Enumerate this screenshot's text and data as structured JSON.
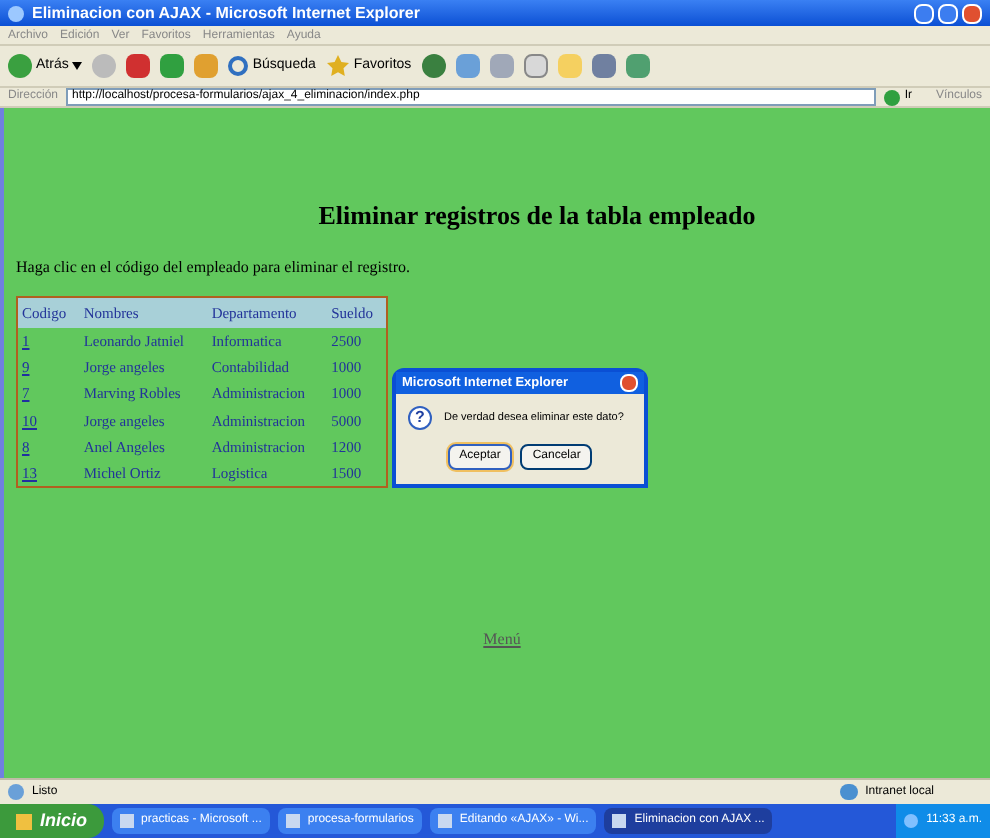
{
  "window": {
    "title": "Eliminacion con AJAX - Microsoft Internet Explorer"
  },
  "menu": [
    "Archivo",
    "Edición",
    "Ver",
    "Favoritos",
    "Herramientas",
    "Ayuda"
  ],
  "toolbar": {
    "back": "Atrás",
    "search": "Búsqueda",
    "favorites": "Favoritos"
  },
  "address": {
    "label": "Dirección",
    "value": "http://localhost/procesa-formularios/ajax_4_eliminacion/index.php",
    "go": "Ir",
    "links": "Vínculos"
  },
  "page": {
    "heading": "Eliminar registros de la tabla empleado",
    "instruction": "Haga clic en el código del empleado para eliminar el registro.",
    "table": {
      "columns": [
        "Codigo",
        "Nombres",
        "Departamento",
        "Sueldo"
      ],
      "rows": [
        [
          "1",
          "Leonardo Jatniel",
          "Informatica",
          "2500"
        ],
        [
          "9",
          "Jorge angeles",
          "Contabilidad",
          "1000"
        ],
        [
          "7",
          "Marving Robles",
          "Administracion",
          "1000"
        ],
        [
          "10",
          "Jorge angeles",
          "Administracion",
          "5000"
        ],
        [
          "8",
          "Anel Angeles",
          "Administracion",
          "1200"
        ],
        [
          "13",
          "Michel Ortiz",
          "Logistica",
          "1500"
        ]
      ]
    },
    "menu_link": "Menú"
  },
  "dialog": {
    "title": "Microsoft Internet Explorer",
    "icon": "?",
    "message": "De verdad desea eliminar este dato?",
    "buttons": [
      {
        "label": "Aceptar",
        "selected": true
      },
      {
        "label": "Cancelar",
        "selected": false
      }
    ]
  },
  "status_bar": {
    "text": "Listo",
    "zone": "Intranet local"
  },
  "taskbar": {
    "start": "Inicio",
    "items": [
      {
        "label": "practicas - Microsoft ...",
        "selected": false
      },
      {
        "label": "procesa-formularios",
        "selected": false
      },
      {
        "label": "Editando «AJAX» - Wi...",
        "selected": false
      },
      {
        "label": "Eliminacion con AJAX ...",
        "selected": true
      }
    ],
    "clock": "11:33 a.m."
  }
}
